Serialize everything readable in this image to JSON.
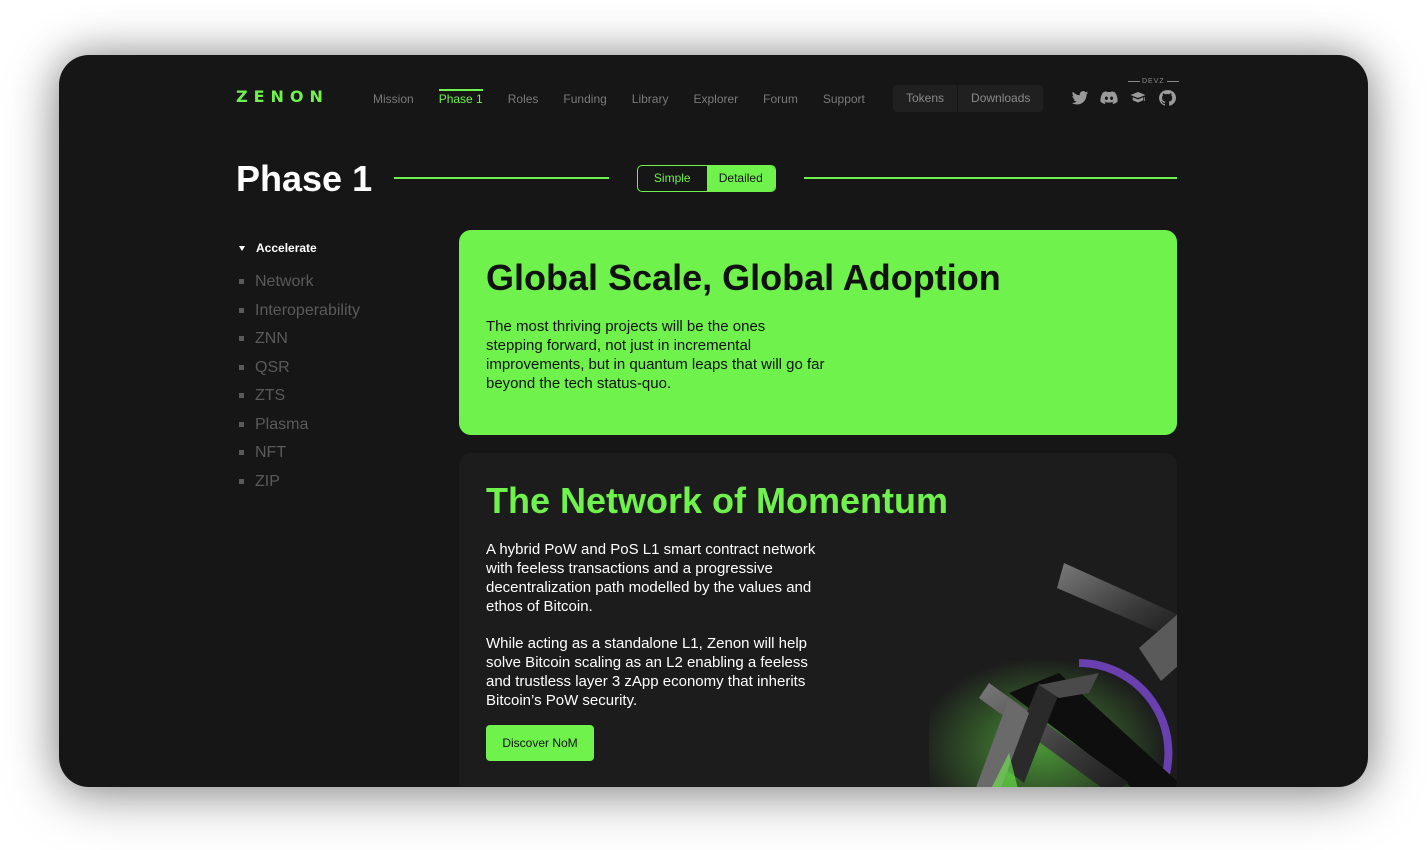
{
  "header": {
    "logo": "ZENON",
    "nav": [
      "Mission",
      "Phase 1",
      "Roles",
      "Funding",
      "Library",
      "Explorer",
      "Forum",
      "Support"
    ],
    "active_nav": "Phase 1",
    "pills": [
      "Tokens",
      "Downloads"
    ],
    "devz_label": "DEVZ",
    "social_icons": [
      "twitter-icon",
      "discord-icon",
      "book-icon",
      "github-icon"
    ]
  },
  "page": {
    "title": "Phase 1",
    "toggle": {
      "simple": "Simple",
      "detailed": "Detailed",
      "selected": "Detailed"
    }
  },
  "sidebar": {
    "heading": "Accelerate",
    "items": [
      "Network",
      "Interoperability",
      "ZNN",
      "QSR",
      "ZTS",
      "Plasma",
      "NFT",
      "ZIP"
    ]
  },
  "cards": [
    {
      "title": "Global Scale, Global Adoption",
      "body": "The most thriving projects will be the ones stepping forward, not just in incremental improvements, but in quantum leaps that will go far beyond the tech status-quo."
    },
    {
      "title": "The Network of Momentum",
      "body1": "A hybrid PoW and PoS L1 smart contract network with feeless transactions and a progressive decentralization path modelled by the values and ethos of Bitcoin.",
      "body2": "While acting as a standalone L1, Zenon will help solve Bitcoin scaling as an L2 enabling a feeless and trustless layer 3 zApp economy that inherits Bitcoin’s PoW security.",
      "cta": "Discover NoM"
    }
  ],
  "colors": {
    "accent": "#6ff24c",
    "background": "#161616",
    "card_dark": "#1c1c1c",
    "muted": "#5a5a5a"
  }
}
